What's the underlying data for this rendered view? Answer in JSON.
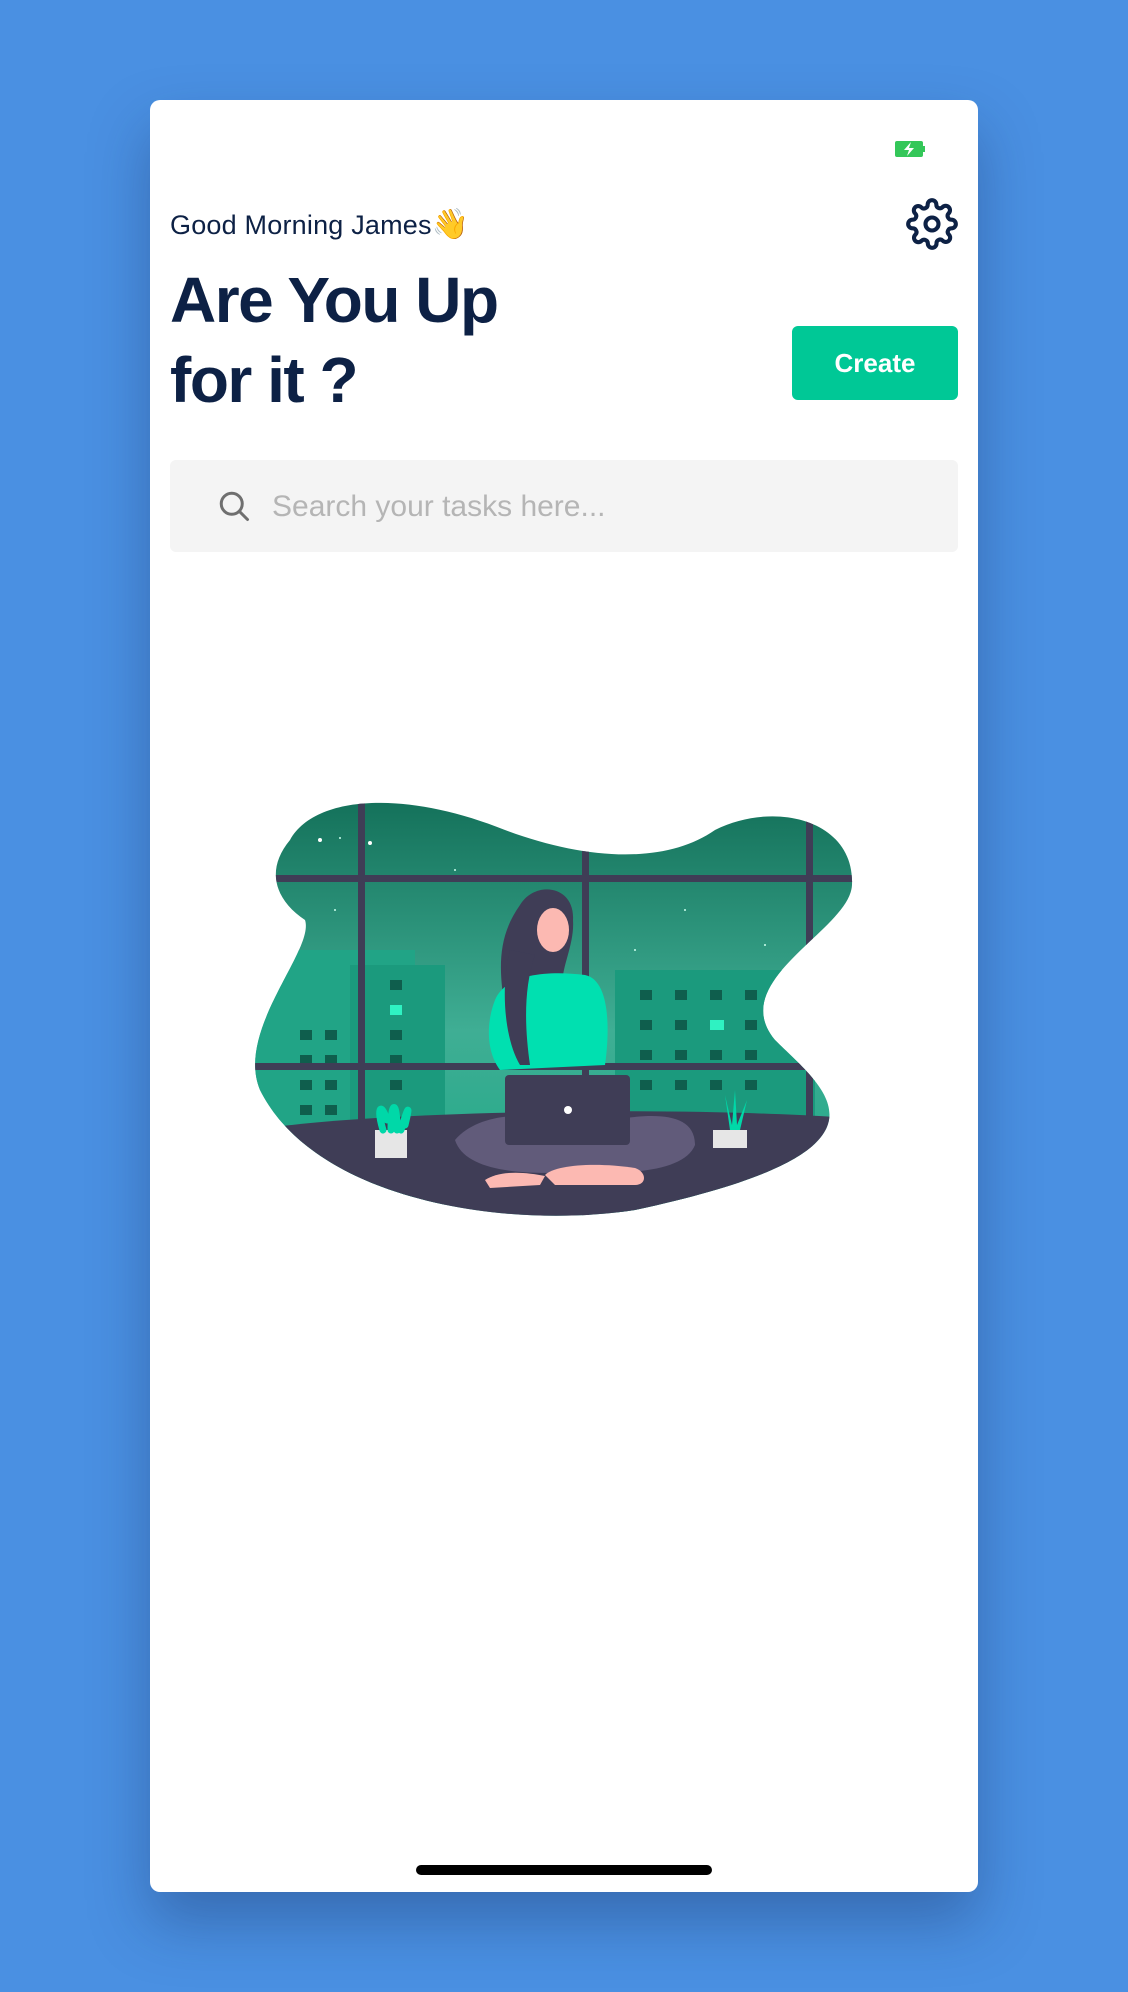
{
  "status_bar": {
    "battery_icon": "battery-charging-icon",
    "battery_color": "#34c759"
  },
  "header": {
    "greeting": "Good Morning James",
    "greeting_emoji": "👋",
    "title_line1": "Are You Up",
    "title_line2": "for it ?",
    "settings_icon": "gear-icon"
  },
  "actions": {
    "create_label": "Create"
  },
  "search": {
    "placeholder": "Search your tasks here...",
    "value": ""
  },
  "illustration": {
    "icon": "empty-state-illustration"
  },
  "colors": {
    "background": "#4a90e2",
    "primary_text": "#0d2145",
    "accent": "#00c896",
    "search_bg": "#f4f4f4",
    "placeholder": "#b5b5b5"
  }
}
